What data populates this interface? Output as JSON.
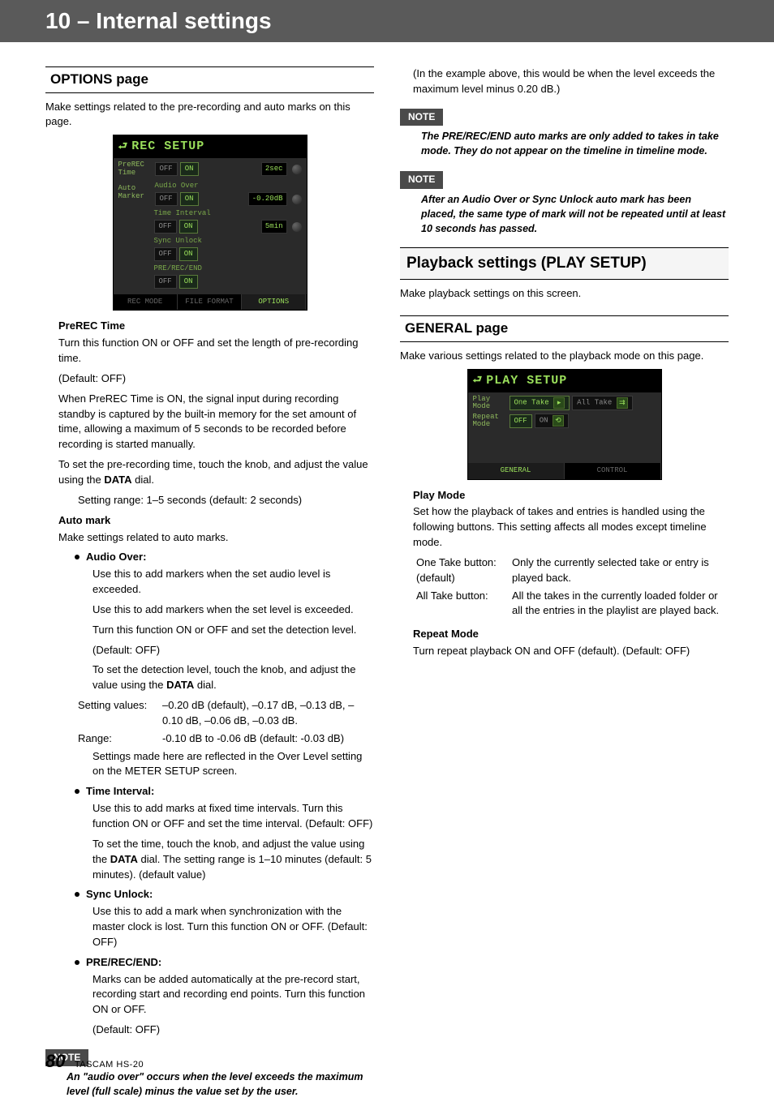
{
  "header": {
    "title": "10 – Internal settings"
  },
  "left": {
    "options_head": "OPTIONS page",
    "options_intro": "Make settings related to the pre-recording and auto marks on this page.",
    "prerec_label": "PreREC Time",
    "prerec_p1": "Turn this function ON or OFF and set the length of pre-recording time.",
    "prerec_default": "(Default: OFF)",
    "prerec_p2": "When PreREC Time is ON, the signal input during recording standby is captured by the built-in memory for the set amount of time, allowing a maximum of 5 seconds to be recorded before recording is started manually.",
    "prerec_p3a": "To set the pre-recording time, touch the knob, and adjust the value using the ",
    "data_dial": "DATA",
    "prerec_p3b": " dial.",
    "prerec_range": "Setting range: 1–5 seconds (default: 2 seconds)",
    "automark_label": "Auto mark",
    "automark_p1": "Make settings related to auto marks.",
    "audio_over_label": "Audio Over:",
    "audio_over_p1": "Use this to add markers when the set audio level is exceeded.",
    "audio_over_p2": "Use this to add markers when the set level is exceeded.",
    "audio_over_p3": "Turn this function ON or OFF and set the detection level.",
    "audio_over_default": "(Default: OFF)",
    "audio_over_p4a": "To set the detection level, touch the knob, and adjust the value using the ",
    "audio_over_p4b": " dial.",
    "setting_values_k": "Setting values:",
    "setting_values_v": "–0.20 dB (default), –0.17 dB, –0.13 dB, –0.10 dB, –0.06 dB, –0.03 dB.",
    "range_k": "Range:",
    "range_v": "-0.10 dB to -0.06 dB (default: -0.03 dB)",
    "audio_over_p5": "Settings made here are reflected in the Over Level setting on the METER SETUP screen.",
    "time_interval_label": "Time Interval:",
    "time_interval_p1": "Use this to add marks at fixed time intervals. Turn this function ON or OFF and set the time interval. (Default: OFF)",
    "time_interval_p2a": "To set the time, touch the knob, and adjust the value using the ",
    "time_interval_p2b": " dial. The setting range is 1–10 minutes (default: 5 minutes). (default value)",
    "sync_unlock_label": "Sync Unlock:",
    "sync_unlock_p1": "Use this to add a mark when synchronization with the master clock is lost. Turn this function ON or OFF. (Default: OFF)",
    "pre_rec_end_label": "PRE/REC/END:",
    "pre_rec_end_p1": "Marks can be added automatically at the pre-record start, recording start and recording end points. Turn this function ON or OFF.",
    "pre_rec_end_default": "(Default: OFF)",
    "note1": "An \"audio over\" occurs when the level exceeds the maximum level (full scale) minus the value set by the user."
  },
  "right": {
    "cont_p": "(In the example above, this would be when the level exceeds the maximum level minus 0.20 dB.)",
    "note2": "The PRE/REC/END auto marks are only added to takes in take mode. They do not appear on the timeline in timeline mode.",
    "note3": "After an Audio Over or Sync Unlock auto mark has been placed, the same type of mark will not be repeated until at least 10 seconds has passed.",
    "play_head": "Playback settings (PLAY SETUP)",
    "play_intro": "Make playback settings on this screen.",
    "general_head": "GENERAL page",
    "general_intro": "Make various settings related to the playback mode on this page.",
    "playmode_label": "Play Mode",
    "playmode_p1": "Set how the playback of takes and entries is handled using the following buttons. This setting affects all modes except timeline mode.",
    "one_take_k": "One Take button: (default)",
    "one_take_v": "Only the currently selected take or entry is played back.",
    "all_take_k": "All Take button:",
    "all_take_v": "All the takes in the currently loaded folder or all the entries in the playlist are played back.",
    "repeat_label": "Repeat Mode",
    "repeat_p1": "Turn repeat playback ON and OFF (default). (Default: OFF)"
  },
  "lcd_rec": {
    "title": "REC SETUP",
    "rows": {
      "prerec": "PreREC Time",
      "off": "OFF",
      "on": "ON",
      "v1": "2sec",
      "auto": "Auto Marker",
      "ao": "Audio Over",
      "v2": "-0.20dB",
      "ti": "Time Interval",
      "v3": "5min",
      "su": "Sync Unlock",
      "pre": "PRE/REC/END"
    },
    "tabs": [
      "REC MODE",
      "FILE FORMAT",
      "OPTIONS"
    ]
  },
  "lcd_play": {
    "title": "PLAY SETUP",
    "playmode": "Play Mode",
    "one": "One Take",
    "all": "All Take",
    "repeat": "Repeat Mode",
    "off": "OFF",
    "on": "ON",
    "tabs": [
      "GENERAL",
      "CONTROL"
    ]
  },
  "note_label": "NOTE",
  "footer": {
    "page": "80",
    "model": "TASCAM HS-20"
  }
}
